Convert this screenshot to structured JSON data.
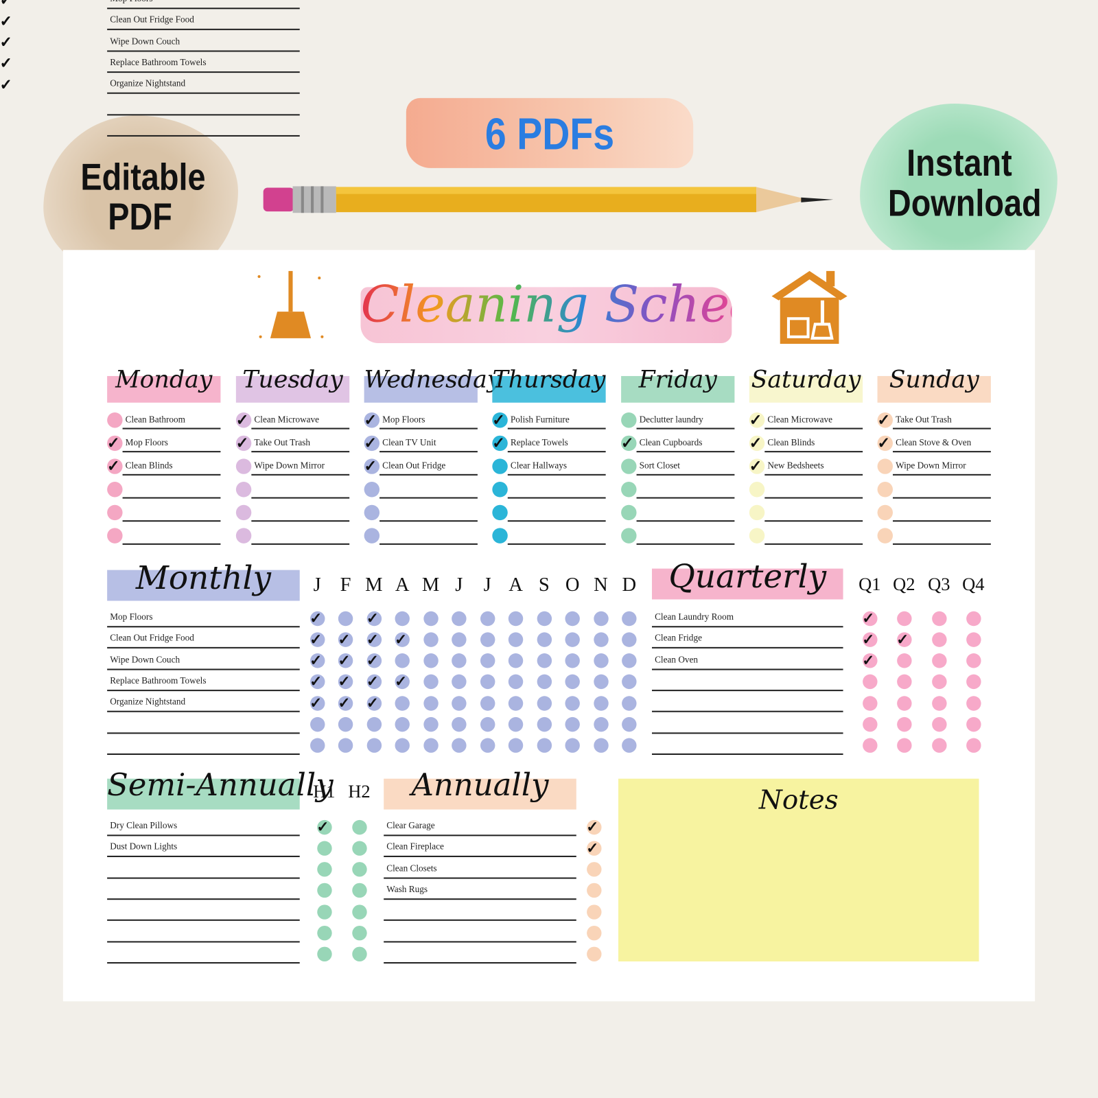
{
  "badges": {
    "editable": "Editable PDF",
    "count": "6 PDFs",
    "instant": "Instant Download",
    "count_color": "#2a7de1"
  },
  "title": "Cleaning Schedule",
  "icons": [
    "broom-icon",
    "house-cleaning-icon",
    "pencil-icon",
    "check-icon"
  ],
  "days": [
    {
      "name": "Monday",
      "color": "#f4a7c3",
      "tasks": [
        {
          "t": "Clean Bathroom",
          "c": false
        },
        {
          "t": "Mop Floors",
          "c": true
        },
        {
          "t": "Clean Blinds",
          "c": true
        },
        {
          "t": "",
          "c": false
        },
        {
          "t": "",
          "c": false
        },
        {
          "t": "",
          "c": false
        }
      ]
    },
    {
      "name": "Tuesday",
      "color": "#dbbadf",
      "tasks": [
        {
          "t": "Clean Microwave",
          "c": true
        },
        {
          "t": "Take Out Trash",
          "c": true
        },
        {
          "t": "Wipe Down Mirror",
          "c": false
        },
        {
          "t": "",
          "c": false
        },
        {
          "t": "",
          "c": false
        },
        {
          "t": "",
          "c": false
        }
      ]
    },
    {
      "name": "Wednesday",
      "color": "#aab4e0",
      "tasks": [
        {
          "t": "Mop Floors",
          "c": true
        },
        {
          "t": "Clean TV Unit",
          "c": true
        },
        {
          "t": "Clean Out Fridge",
          "c": true
        },
        {
          "t": "",
          "c": false
        },
        {
          "t": "",
          "c": false
        },
        {
          "t": "",
          "c": false
        }
      ]
    },
    {
      "name": "Thursday",
      "color": "#2bb5d8",
      "tasks": [
        {
          "t": "Polish Furniture",
          "c": true
        },
        {
          "t": "Replace Towels",
          "c": true
        },
        {
          "t": "Clear Hallways",
          "c": false
        },
        {
          "t": "",
          "c": false
        },
        {
          "t": "",
          "c": false
        },
        {
          "t": "",
          "c": false
        }
      ]
    },
    {
      "name": "Friday",
      "color": "#98d6b7",
      "tasks": [
        {
          "t": "Declutter laundry",
          "c": false
        },
        {
          "t": "Clean Cupboards",
          "c": true
        },
        {
          "t": "Sort Closet",
          "c": false
        },
        {
          "t": "",
          "c": false
        },
        {
          "t": "",
          "c": false
        },
        {
          "t": "",
          "c": false
        }
      ]
    },
    {
      "name": "Saturday",
      "color": "#f7f5c6",
      "tasks": [
        {
          "t": "Clean Microwave",
          "c": true
        },
        {
          "t": "Clean Blinds",
          "c": true
        },
        {
          "t": "New Bedsheets",
          "c": true
        },
        {
          "t": "",
          "c": false
        },
        {
          "t": "",
          "c": false
        },
        {
          "t": "",
          "c": false
        }
      ]
    },
    {
      "name": "Sunday",
      "color": "#f9d4b8",
      "tasks": [
        {
          "t": "Take Out Trash",
          "c": true
        },
        {
          "t": "Clean Stove & Oven",
          "c": true
        },
        {
          "t": "Wipe Down Mirror",
          "c": false
        },
        {
          "t": "",
          "c": false
        },
        {
          "t": "",
          "c": false
        },
        {
          "t": "",
          "c": false
        }
      ]
    }
  ],
  "monthly": {
    "title": "Monthly",
    "color": "#aab4e0",
    "months": [
      "J",
      "F",
      "M",
      "A",
      "M",
      "J",
      "J",
      "A",
      "S",
      "O",
      "N",
      "D"
    ],
    "rows": [
      {
        "t": "Mop Floors",
        "checks": [
          1,
          0,
          1,
          0,
          0,
          0,
          0,
          0,
          0,
          0,
          0,
          0
        ]
      },
      {
        "t": "Clean Out Fridge Food",
        "checks": [
          1,
          1,
          1,
          1,
          0,
          0,
          0,
          0,
          0,
          0,
          0,
          0
        ]
      },
      {
        "t": "Wipe Down Couch",
        "checks": [
          1,
          1,
          1,
          0,
          0,
          0,
          0,
          0,
          0,
          0,
          0,
          0
        ]
      },
      {
        "t": "Replace Bathroom Towels",
        "checks": [
          1,
          1,
          1,
          1,
          0,
          0,
          0,
          0,
          0,
          0,
          0,
          0
        ]
      },
      {
        "t": "Organize Nightstand",
        "checks": [
          1,
          1,
          1,
          0,
          0,
          0,
          0,
          0,
          0,
          0,
          0,
          0
        ]
      },
      {
        "t": "",
        "checks": [
          0,
          0,
          0,
          0,
          0,
          0,
          0,
          0,
          0,
          0,
          0,
          0
        ]
      },
      {
        "t": "",
        "checks": [
          0,
          0,
          0,
          0,
          0,
          0,
          0,
          0,
          0,
          0,
          0,
          0
        ]
      }
    ]
  },
  "quarterly": {
    "title": "Quarterly",
    "color": "#f4a7c3",
    "dot_color": "#f7a9c9",
    "periods": [
      "Q1",
      "Q2",
      "Q3",
      "Q4"
    ],
    "rows": [
      {
        "t": "Clean Laundry Room",
        "checks": [
          1,
          0,
          0,
          0
        ]
      },
      {
        "t": "Clean Fridge",
        "checks": [
          1,
          1,
          0,
          0
        ]
      },
      {
        "t": "Clean Oven",
        "checks": [
          1,
          0,
          0,
          0
        ]
      },
      {
        "t": "",
        "checks": [
          0,
          0,
          0,
          0
        ]
      },
      {
        "t": "",
        "checks": [
          0,
          0,
          0,
          0
        ]
      },
      {
        "t": "",
        "checks": [
          0,
          0,
          0,
          0
        ]
      },
      {
        "t": "",
        "checks": [
          0,
          0,
          0,
          0
        ]
      }
    ]
  },
  "semi_annually": {
    "title": "Semi-Annually",
    "color": "#98d6b7",
    "periods": [
      "H1",
      "H2"
    ],
    "rows": [
      {
        "t": "Dry Clean Pillows",
        "checks": [
          1,
          0
        ]
      },
      {
        "t": "Dust Down Lights",
        "checks": [
          0,
          0
        ]
      },
      {
        "t": "",
        "checks": [
          0,
          0
        ]
      },
      {
        "t": "",
        "checks": [
          0,
          0
        ]
      },
      {
        "t": "",
        "checks": [
          0,
          0
        ]
      },
      {
        "t": "",
        "checks": [
          0,
          0
        ]
      },
      {
        "t": "",
        "checks": [
          0,
          0
        ]
      }
    ]
  },
  "annually": {
    "title": "Annually",
    "color": "#f9d4b8",
    "rows": [
      {
        "t": "Clear Garage",
        "checks": [
          1
        ]
      },
      {
        "t": "Clean Fireplace",
        "checks": [
          1
        ]
      },
      {
        "t": "Clean Closets",
        "checks": [
          0
        ]
      },
      {
        "t": "Wash Rugs",
        "checks": [
          0
        ]
      },
      {
        "t": "",
        "checks": [
          0
        ]
      },
      {
        "t": "",
        "checks": [
          0
        ]
      },
      {
        "t": "",
        "checks": [
          0
        ]
      }
    ]
  },
  "notes": {
    "title": "Notes",
    "color": "#f7f3a0"
  }
}
